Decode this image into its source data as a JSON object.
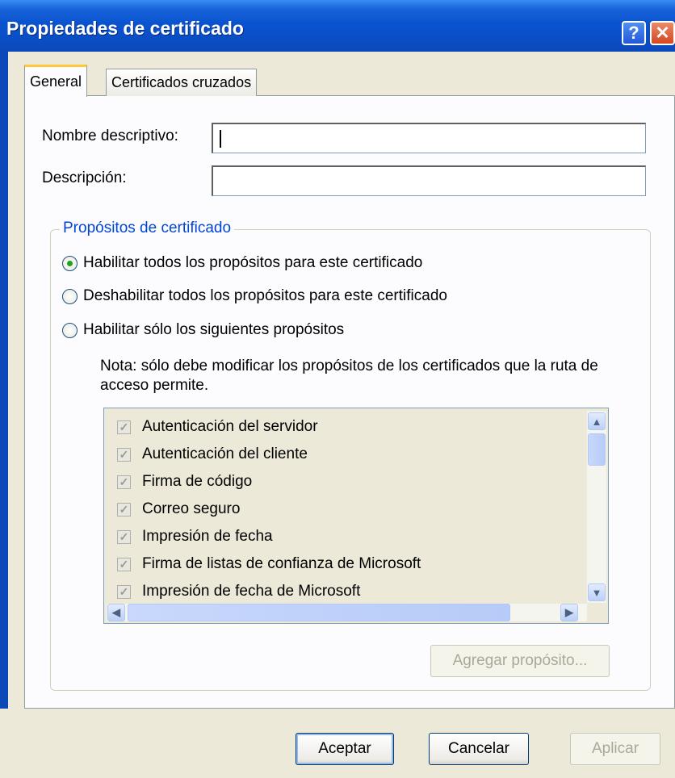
{
  "window": {
    "title": "Propiedades de certificado"
  },
  "titlebar": {
    "help_glyph": "?",
    "close_glyph": "✕"
  },
  "tabs": [
    {
      "label": "General",
      "selected": true
    },
    {
      "label": "Certificados cruzados",
      "selected": false
    }
  ],
  "fields": {
    "friendly_name": {
      "label": "Nombre descriptivo:",
      "value": ""
    },
    "description": {
      "label": "Descripción:",
      "value": ""
    }
  },
  "purposes": {
    "group_title": "Propósitos de certificado",
    "options": [
      {
        "label": "Habilitar todos los propósitos para este certificado",
        "selected": true
      },
      {
        "label": "Deshabilitar todos los propósitos para este certificado",
        "selected": false
      },
      {
        "label": "Habilitar sólo los siguientes propósitos",
        "selected": false
      }
    ],
    "note": "Nota: sólo debe modificar los propósitos de los certificados que la ruta de acceso permite.",
    "list": [
      {
        "label": "Autenticación del servidor",
        "checked": true
      },
      {
        "label": "Autenticación del cliente",
        "checked": true
      },
      {
        "label": "Firma de código",
        "checked": true
      },
      {
        "label": "Correo seguro",
        "checked": true
      },
      {
        "label": "Impresión de fecha",
        "checked": true
      },
      {
        "label": "Firma de listas de confianza de Microsoft",
        "checked": true
      },
      {
        "label": "Impresión de fecha de Microsoft",
        "checked": true
      }
    ],
    "add_button": "Agregar propósito..."
  },
  "buttons": {
    "ok": "Aceptar",
    "cancel": "Cancelar",
    "apply": "Aplicar"
  },
  "colors": {
    "title_bar": "#0a53d0",
    "group_title": "#0046d5",
    "face": "#ece9d8"
  }
}
